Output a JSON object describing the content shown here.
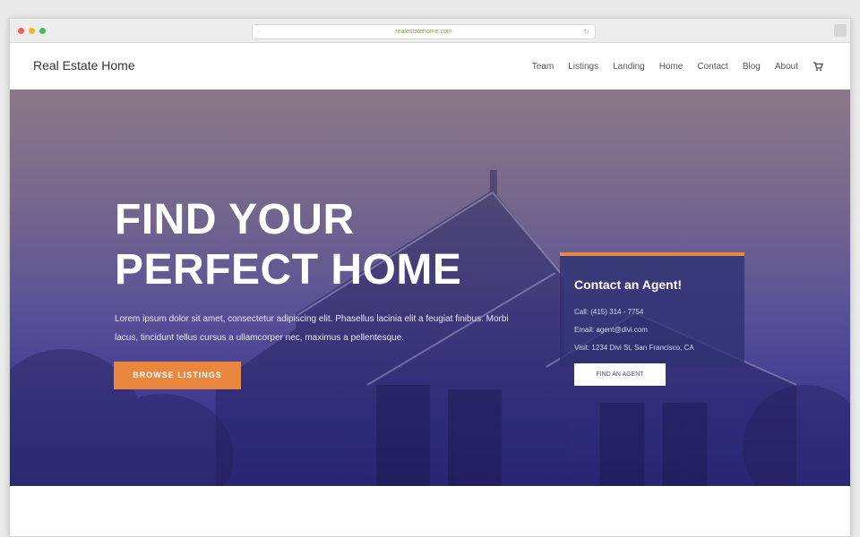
{
  "browser": {
    "url": "realestatehome.com",
    "addr_left_icon": "◦",
    "addr_right_icon": "↻"
  },
  "site": {
    "logo": "Real Estate Home",
    "nav": [
      "Team",
      "Listings",
      "Landing",
      "Home",
      "Contact",
      "Blog",
      "About"
    ],
    "cart_icon": "cart-icon"
  },
  "hero": {
    "title_line1": "FIND YOUR",
    "title_line2": "PERFECT HOME",
    "subtitle": "Lorem ipsum dolor sit amet, consectetur adipiscing elit. Phasellus lacinia elit a feugiat finibus. Morbi lacus, tincidunt tellus cursus a ullamcorper nec, maximus a pellentesque.",
    "button": "BROWSE LISTINGS",
    "accent_color": "#e8873d"
  },
  "contact": {
    "title": "Contact an Agent!",
    "phone": "Call: (415) 314 - 7754",
    "email": "Email: agent@divi.com",
    "address": "Visit: 1234 Divi St, San Francisco, CA",
    "button": "FIND AN AGENT"
  },
  "colors": {
    "window_close": "#ee5f57",
    "window_min": "#f5b22d",
    "window_max": "#3ec04a"
  }
}
